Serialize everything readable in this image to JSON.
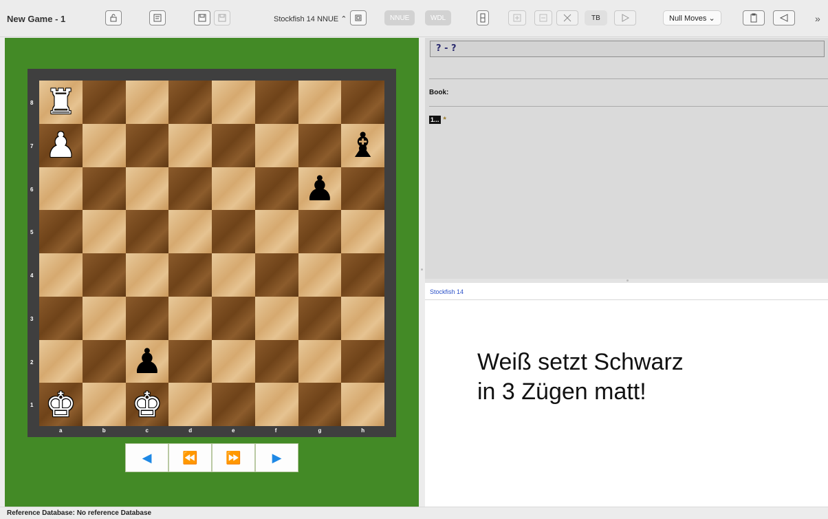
{
  "window": {
    "title": "New Game - 1"
  },
  "toolbar": {
    "engine_select": "Stockfish 14 NNUE ⌃",
    "nnue_label": "NNUE",
    "wdl_label": "WDL",
    "tb_label": "TB",
    "null_moves_select": "Null Moves ⌄",
    "more_label": "»"
  },
  "board": {
    "ranks": [
      "8",
      "7",
      "6",
      "5",
      "4",
      "3",
      "2",
      "1"
    ],
    "files": [
      "a",
      "b",
      "c",
      "d",
      "e",
      "f",
      "g",
      "h"
    ],
    "pieces": [
      {
        "square": "a8",
        "glyph": "♜",
        "color": "white"
      },
      {
        "square": "a7",
        "glyph": "♟",
        "color": "white"
      },
      {
        "square": "h7",
        "glyph": "♝",
        "color": "black"
      },
      {
        "square": "g6",
        "glyph": "♟",
        "color": "black"
      },
      {
        "square": "c2",
        "glyph": "♟",
        "color": "black"
      },
      {
        "square": "a1",
        "glyph": "♚",
        "color": "white"
      },
      {
        "square": "c1",
        "glyph": "♚",
        "color": "white"
      }
    ],
    "light_color": "#dcb37e",
    "dark_color": "#744a1f",
    "frame_color": "#3f3f3f",
    "panel_color": "#438a26"
  },
  "nav": {
    "buttons": [
      {
        "name": "prev-move-button",
        "glyph": "◀"
      },
      {
        "name": "start-button",
        "glyph": "⏪"
      },
      {
        "name": "end-button",
        "glyph": "⏩"
      },
      {
        "name": "next-move-button",
        "glyph": "▶"
      }
    ],
    "accent": "#1e88e5"
  },
  "notation": {
    "result": "? - ?",
    "book_label": "Book:",
    "move_number": "1...",
    "move_text": "*"
  },
  "engine": {
    "name": "Stockfish 14",
    "puzzle_line1": "Weiß setzt Schwarz",
    "puzzle_line2": "in 3 Zügen matt!"
  },
  "status": {
    "text": "Reference Database: No reference Database"
  }
}
